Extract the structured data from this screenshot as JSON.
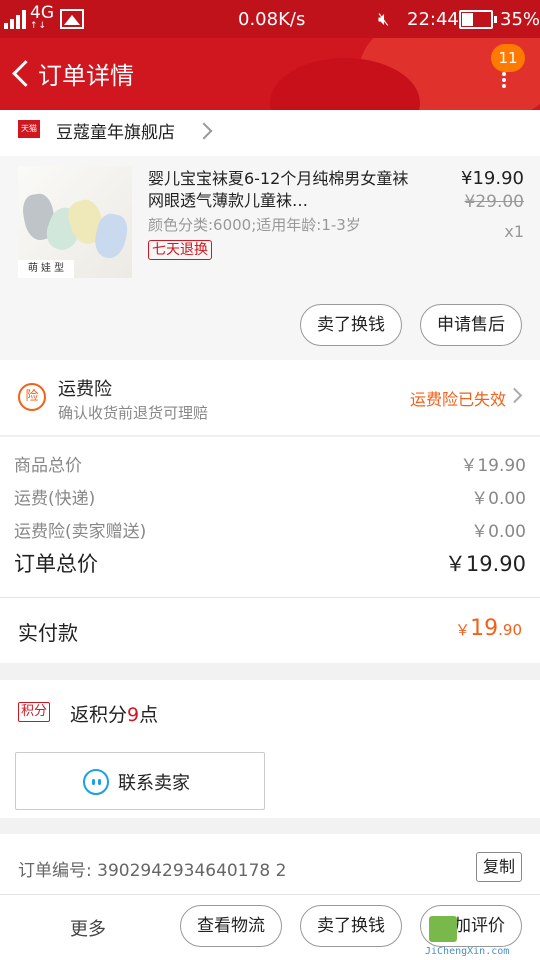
{
  "statusbar": {
    "network": "4G",
    "speed": "0.08K/s",
    "time": "22:44",
    "battery": "35%",
    "battery_level": 0.35
  },
  "header": {
    "title": "订单详情",
    "message_count": "11"
  },
  "shop": {
    "badge": "天猫",
    "name": "豆蔻童年旗舰店"
  },
  "product": {
    "title": "婴儿宝宝袜夏6-12个月纯棉男女童袜网眼透气薄款儿童袜…",
    "sku": "颜色分类:6000;适用年龄:1-3岁",
    "tag": "七天退换",
    "image_label": "萌 娃 型",
    "price": "¥19.90",
    "original_price": "¥29.00",
    "quantity": "x1",
    "buttons": {
      "sell": "卖了换钱",
      "after_sales": "申请售后"
    }
  },
  "insurance": {
    "icon": "险",
    "title": "运费险",
    "subtitle": "确认收货前退货可理赔",
    "status": "运费险已失效"
  },
  "prices": {
    "rows": [
      {
        "label": "商品总价",
        "value": "￥19.90"
      },
      {
        "label": "运费(快递)",
        "value": "￥0.00"
      },
      {
        "label": "运费险(卖家赠送)",
        "value": "￥0.00"
      }
    ],
    "total_label": "订单总价",
    "total_value": "￥19.90"
  },
  "paid": {
    "label": "实付款",
    "currency": "￥",
    "integer": "19",
    "decimal": ".90"
  },
  "points": {
    "tag": "积分",
    "prefix": "返积分",
    "value": "9",
    "suffix": "点"
  },
  "contact": {
    "label": "联系卖家"
  },
  "order": {
    "number_label": "订单编号:",
    "number": "3902942934640178 2",
    "copy": "复制"
  },
  "bottombar": {
    "more": "更多",
    "logistics": "查看物流",
    "sell": "卖了换钱",
    "review": "追加评价"
  },
  "watermark": {
    "url": "JiChengXin.com"
  }
}
